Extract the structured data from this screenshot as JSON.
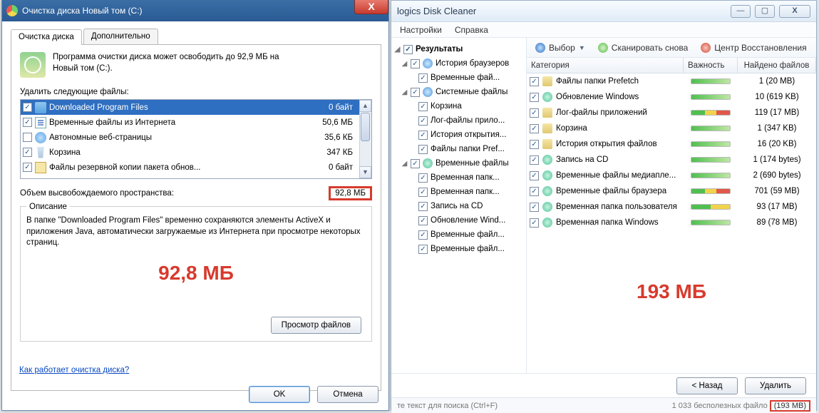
{
  "left": {
    "title": "Очистка диска Новый том (C:)",
    "tabs": {
      "main": "Очистка диска",
      "extra": "Дополнительно"
    },
    "header_text_1": "Программа очистки диска может освободить до 92,9 МБ на",
    "header_text_2": "Новый том (C:).",
    "list_label": "Удалить следующие файлы:",
    "files": [
      {
        "chk": true,
        "name": "Downloaded Program Files",
        "size": "0 байт",
        "sel": true,
        "icon": "folder"
      },
      {
        "chk": true,
        "name": "Временные файлы из Интернета",
        "size": "50,6 МБ",
        "sel": false,
        "icon": "page"
      },
      {
        "chk": false,
        "name": "Автономные веб-страницы",
        "size": "35,6 КБ",
        "sel": false,
        "icon": "globe"
      },
      {
        "chk": true,
        "name": "Корзина",
        "size": "347 КБ",
        "sel": false,
        "icon": "bin"
      },
      {
        "chk": true,
        "name": "Файлы резервной копии пакета обнов...",
        "size": "0 байт",
        "sel": false,
        "icon": "pack"
      }
    ],
    "total_label": "Объем высвобождаемого пространства:",
    "total_value": "92,8 МБ",
    "desc_title": "Описание",
    "desc_text": "В папке \"Downloaded Program Files\" временно сохраняются элементы ActiveX и приложения Java, автоматически загружаемые из Интернета при просмотре некоторых страниц.",
    "big_label": "92,8 МБ",
    "view_files": "Просмотр файлов",
    "help_link": "Как работает очистка диска?",
    "ok": "OK",
    "cancel": "Отмена"
  },
  "right": {
    "title": "logics Disk Cleaner",
    "menu": {
      "settings": "Настройки",
      "help": "Справка"
    },
    "toolbar": {
      "select": "Выбор",
      "rescan": "Сканировать снова",
      "rescue": "Центр Восстановления"
    },
    "tree": {
      "root": "Результаты",
      "n_browser": "История браузеров",
      "n_browser_tmp": "Временные фай...",
      "n_sys": "Системные файлы",
      "n_sys_bin": "Корзина",
      "n_sys_log": "Лог-файлы прило...",
      "n_sys_hist": "История открытия...",
      "n_sys_pref": "Файлы папки Pref...",
      "n_tmp": "Временные файлы",
      "n_tmp_dir1": "Временная папк...",
      "n_tmp_dir2": "Временная папк...",
      "n_tmp_cd": "Запись на CD",
      "n_tmp_upd": "Обновление Wind...",
      "n_tmp_media": "Временные файл...",
      "n_tmp_br": "Временные файл..."
    },
    "cols": {
      "cat": "Категория",
      "imp": "Важность",
      "cnt": "Найдено файлов"
    },
    "rows": [
      {
        "name": "Файлы папки Prefetch",
        "bar": "g",
        "cnt": "1 (20 MB)",
        "icon": "fd"
      },
      {
        "name": "Обновление Windows",
        "bar": "g",
        "cnt": "10 (619 KB)",
        "icon": "cd"
      },
      {
        "name": "Лог-файлы приложений",
        "bar": "r",
        "cnt": "119 (17 MB)",
        "icon": "fd"
      },
      {
        "name": "Корзина",
        "bar": "g",
        "cnt": "1 (347 KB)",
        "icon": "fd"
      },
      {
        "name": "История открытия файлов",
        "bar": "g",
        "cnt": "16 (20 KB)",
        "icon": "fd"
      },
      {
        "name": "Запись на CD",
        "bar": "g",
        "cnt": "1 (174 bytes)",
        "icon": "cd"
      },
      {
        "name": "Временные файлы медиапле...",
        "bar": "g",
        "cnt": "2 (690 bytes)",
        "icon": "cd"
      },
      {
        "name": "Временные файлы браузера",
        "bar": "r",
        "cnt": "701 (59 MB)",
        "icon": "cd"
      },
      {
        "name": "Временная папка пользователя",
        "bar": "y",
        "cnt": "93 (17 MB)",
        "icon": "cd"
      },
      {
        "name": "Временная папка Windows",
        "bar": "g",
        "cnt": "89 (78 MB)",
        "icon": "cd"
      }
    ],
    "big_label": "193 МБ",
    "back": "< Назад",
    "delete": "Удалить",
    "status_hint": "те текст для поиска (Ctrl+F)",
    "status_count": "1 033 бесполезных файло",
    "status_total": "(193 MB)"
  }
}
